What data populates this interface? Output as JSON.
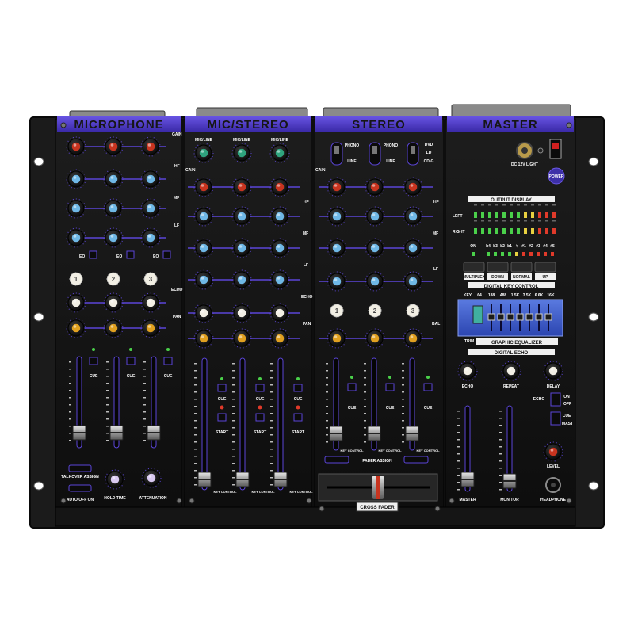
{
  "colors": {
    "panel": "#141414",
    "rack": "#1c1c1c",
    "accent": "#5b45d8",
    "red_knob": "#c8341f",
    "blue_knob": "#6fb8e6",
    "green_knob": "#2fa37e",
    "yellow_knob": "#e0a020",
    "white_knob": "#f2efe4",
    "led_green": "#4ad04a",
    "led_yellow": "#e8d040",
    "led_red": "#e03a2a"
  },
  "sections": {
    "microphone": "MICROPHONE",
    "mic_stereo": "MIC/STEREO",
    "stereo": "STEREO",
    "master": "MASTER"
  },
  "row_labels": {
    "gain": "GAIN",
    "hf": "HF",
    "mf": "MF",
    "lf": "LF",
    "echo": "ECHO",
    "pan": "PAN",
    "bal": "BAL",
    "eq": "EQ",
    "cue": "CUE",
    "start": "START",
    "key_control": "KEY CONTROL"
  },
  "inputs": {
    "mic_line": "MIC/LINE",
    "phono": "PHONO",
    "line": "LINE",
    "dvd": "DVD",
    "ld": "LD",
    "cdg": "CD-G"
  },
  "channel_numbers": [
    "1",
    "2",
    "3"
  ],
  "mic_controls": {
    "talkover_assign": "TALKOVER ASSIGN",
    "auto_off_on": "AUTO OFF ON",
    "hold_time": "HOLD TIME",
    "attenuation": "ATTENUATION"
  },
  "stereo_controls": {
    "fader_assign": "FADER ASSIGN",
    "cross_fader": "CROSS FADER"
  },
  "master": {
    "dc_light": "DC 12V LIGHT",
    "power": "POWER",
    "output_display": "OUTPUT DISPLAY",
    "left": "LEFT",
    "right": "RIGHT",
    "on": "ON",
    "key_codes": [
      "b4",
      "b3",
      "b2",
      "b1",
      "♮",
      "#1",
      "#2",
      "#3",
      "#4",
      "#5"
    ],
    "buttons": [
      "MULTIPLEX",
      "DOWN",
      "NORMAL",
      "UP"
    ],
    "digital_key_control": "DIGITAL KEY CONTROL",
    "eq_freqs": [
      "KEY",
      "64",
      "188",
      "488",
      "1.5K",
      "3.5K",
      "6.6K",
      "16K"
    ],
    "trim": "TRIM",
    "graphic_equalizer": "GRAPHIC EQUALIZER",
    "digital_echo": "DIGITAL ECHO",
    "echo": "ECHO",
    "repeat": "REPEAT",
    "delay": "DELAY",
    "echo_switch": "ECHO",
    "on_label": "ON",
    "off_label": "OFF",
    "cue": "CUE",
    "mast": "MAST",
    "level": "LEVEL",
    "master_fader": "MASTER",
    "monitor_fader": "MONITOR",
    "headphone": "HEADPHONE"
  }
}
